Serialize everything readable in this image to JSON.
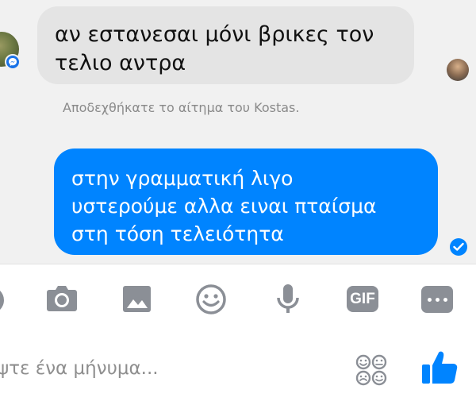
{
  "conversation": {
    "messages": [
      {
        "direction": "incoming",
        "text": "αν εστανεσαι μόνι βρικες τον\nτελιο αντρα"
      },
      {
        "direction": "outgoing",
        "text": "στην γραμματική λιγο\nυστερούμε αλλα ειναι πταίσμα\nστη τόση τελειότητα"
      }
    ],
    "system_notice": "Αποδεχθήκατε το αίτημα του Kostas."
  },
  "toolbar": {
    "gif_label": "GIF"
  },
  "composer": {
    "placeholder": "ψτε ένα μήνυμα..."
  },
  "colors": {
    "accent": "#0084ff",
    "incoming_bubble": "#e4e4e4",
    "icon_gray": "#8b8f96"
  }
}
